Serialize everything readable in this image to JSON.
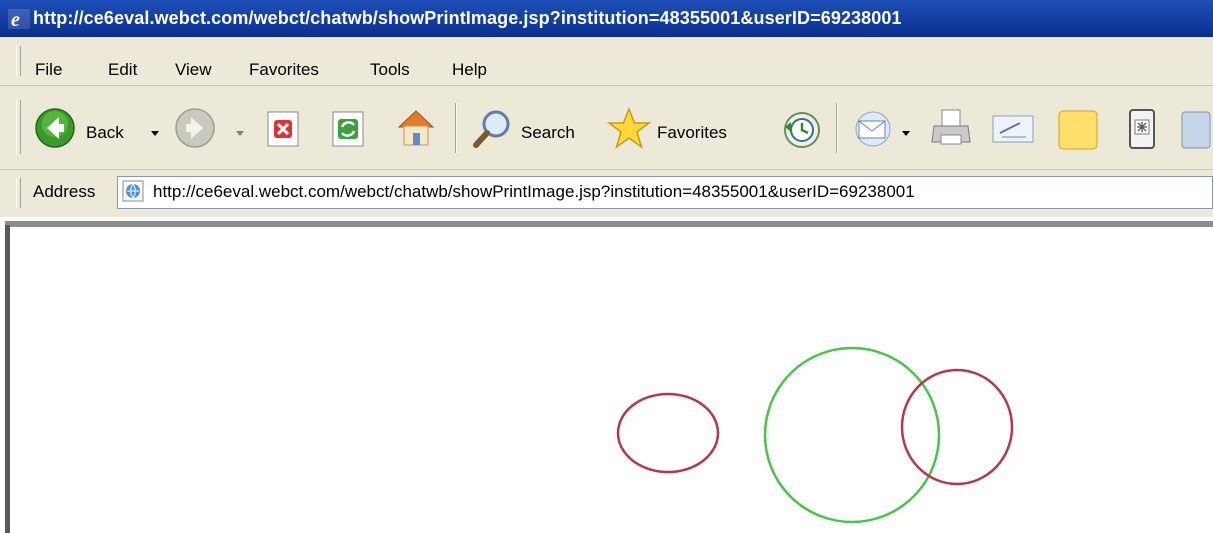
{
  "window": {
    "title": "http://ce6eval.webct.com/webct/chatwb/showPrintImage.jsp?institution=48355001&userID=69238001"
  },
  "menu": {
    "items": [
      "File",
      "Edit",
      "View",
      "Favorites",
      "Tools",
      "Help"
    ]
  },
  "toolbar": {
    "back_label": "Back",
    "search_label": "Search",
    "favorites_label": "Favorites"
  },
  "address": {
    "label": "Address",
    "url": "http://ce6eval.webct.com/webct/chatwb/showPrintImage.jsp?institution=48355001&userID=69238001"
  },
  "whiteboard": {
    "shapes": [
      {
        "shape": "ellipse",
        "color": "#b23a48"
      },
      {
        "shape": "circle",
        "color": "#4cc24c"
      },
      {
        "shape": "circle",
        "color": "#b23a48"
      }
    ]
  },
  "colors": {
    "titlebar": "#0b2f8f",
    "chrome": "#ece9d8",
    "red_stroke": "#b23a48",
    "green_stroke": "#4cc24c"
  }
}
